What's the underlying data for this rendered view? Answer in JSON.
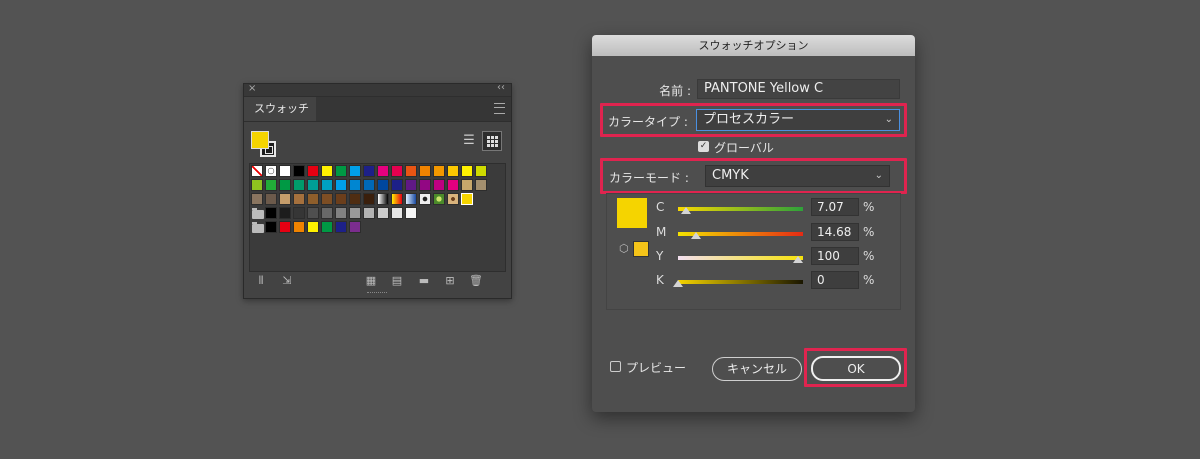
{
  "swatch_panel": {
    "close_glyph": "×",
    "collapse_glyph": "‹‹",
    "tab_label": "スウォッチ",
    "fill_color": "#f5d400",
    "stroke_color": "#1d1d1d",
    "rows": [
      [
        "none",
        "registration",
        "#ffffff",
        "#000000",
        "#e60012",
        "#fff100",
        "#009944",
        "#00a0e9",
        "#1d2088",
        "#e4007f",
        "#e5004f",
        "#e95513",
        "#f08300",
        "#f39800",
        "#fcc800",
        "#fff100",
        "#cfdb00"
      ],
      [
        "#8fc31f",
        "#22ac38",
        "#009944",
        "#009b6b",
        "#009e96",
        "#00a0c1",
        "#00a0e9",
        "#0086d1",
        "#0068b7",
        "#00479d",
        "#1d2088",
        "#601986",
        "#920783",
        "#be0081",
        "#e4007f",
        "#c8a86b",
        "#a38f6e"
      ],
      [
        "#8a7560",
        "#6c5a4b",
        "#c59d6b",
        "#a5703d",
        "#8e5e2b",
        "#7d4e24",
        "#6b3e1b",
        "#4f2d12",
        "#3a1f0c",
        "gradient-bw",
        "gradient-color",
        "gradient-blue",
        "pattern-dots",
        "pattern-green",
        "pattern-leopard",
        "pattern-yellow"
      ],
      [
        "#000000",
        "#1d1d1d",
        "#363636",
        "#4f4f4f",
        "#686868",
        "#818181",
        "#9a9a9a",
        "#b3b3b3",
        "#cccccc",
        "#e5e5e5",
        "#f5f5f5"
      ],
      [
        "#000000",
        "#e60012",
        "#f08300",
        "#fff100",
        "#009944",
        "#1d2088",
        "#7b2d8e"
      ]
    ],
    "folder_rows": [
      3,
      4
    ],
    "footer_icons": [
      "library-icon",
      "place-swatch-icon",
      "new-group-icon",
      "swatch-options-icon",
      "new-folder-icon",
      "new-swatch-icon",
      "delete-icon"
    ]
  },
  "dialog": {
    "title": "スウォッチオプション",
    "name_label": "名前 :",
    "name_value": "PANTONE Yellow C",
    "color_type_label": "カラータイプ :",
    "color_type_value": "プロセスカラー",
    "global_label": "グローバル",
    "global_checked": true,
    "color_mode_label": "カラーモード :",
    "color_mode_value": "CMYK",
    "preview_color": "#f5d400",
    "gamut_color": "#f5c419",
    "channels": [
      {
        "key": "C",
        "value": "7.07",
        "unit": "%",
        "fraction": 0.0707,
        "track": "linear-gradient(to right,#f8d800,#2ea13a)"
      },
      {
        "key": "M",
        "value": "14.68",
        "unit": "%",
        "fraction": 0.1468,
        "track": "linear-gradient(to right,#f5e300,#e52a14)"
      },
      {
        "key": "Y",
        "value": "100",
        "unit": "%",
        "fraction": 1.0,
        "track": "linear-gradient(to right,#f3e0f0,#f6e30a)"
      },
      {
        "key": "K",
        "value": "0",
        "unit": "%",
        "fraction": 0,
        "track": "linear-gradient(to right,#f5d400,#1a1600)"
      }
    ],
    "preview_label": "プレビュー",
    "cancel_label": "キャンセル",
    "ok_label": "OK",
    "highlight_color": "#e0244f"
  }
}
